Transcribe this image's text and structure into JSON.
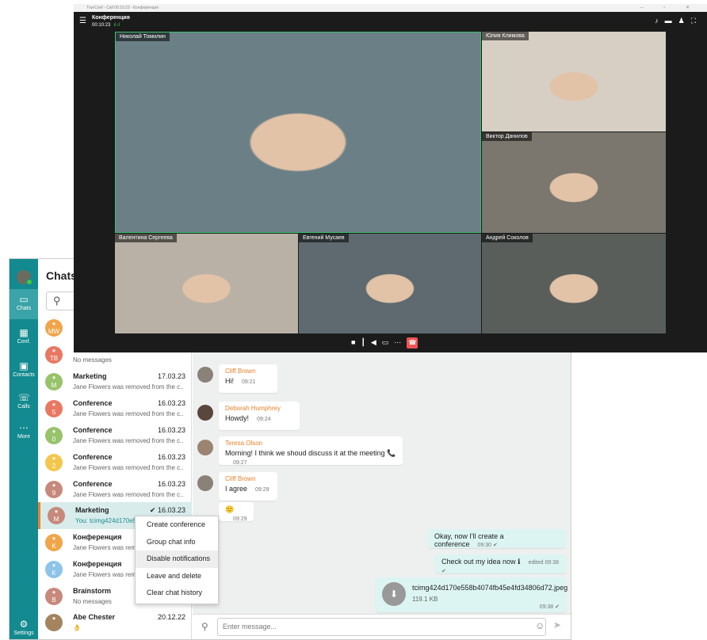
{
  "call": {
    "window_title": "TrueConf - Call 00:10:23 - Конференция",
    "conf_title": "Конференция",
    "timer": "00:10:23",
    "signal": "ıl ıl",
    "participants": [
      {
        "name": "Николай Томилин",
        "bg": "#6b7f86"
      },
      {
        "name": "Юлия Климова",
        "bg": "#d7cfc4"
      },
      {
        "name": "Виктор Данилов",
        "bg": "#7b766e"
      },
      {
        "name": "Валентина Сергеева",
        "bg": "#b9b1a6"
      },
      {
        "name": "Евгений Мусаев",
        "bg": "#5f6a70"
      },
      {
        "name": "Андрей Соколов",
        "bg": "#5a5e5b"
      }
    ]
  },
  "sidebar": {
    "items": [
      {
        "label": "Chats"
      },
      {
        "label": "Conf."
      },
      {
        "label": "Contacts"
      },
      {
        "label": "Calls"
      },
      {
        "label": "More"
      },
      {
        "label": "Settings"
      }
    ]
  },
  "chats": {
    "title": "Chats",
    "rows": [
      {
        "initials": "MW",
        "name": "",
        "date": "",
        "sub": "",
        "color": "#f0a54a"
      },
      {
        "initials": "TB",
        "name": "",
        "date": "",
        "sub": "No messages",
        "color": "#e97862"
      },
      {
        "initials": "M",
        "name": "Marketing",
        "date": "17.03.23",
        "sub": "Jane Flowers was removed from the c...",
        "color": "#97c36b"
      },
      {
        "initials": "5",
        "name": "Conference",
        "date": "16.03.23",
        "sub": "Jane Flowers was removed from the c...",
        "color": "#e97862"
      },
      {
        "initials": "0",
        "name": "Conference",
        "date": "16.03.23",
        "sub": "Jane Flowers was removed from the c...",
        "color": "#97c36b"
      },
      {
        "initials": "2",
        "name": "Conference",
        "date": "16.03.23",
        "sub": "Jane Flowers was removed from the c...",
        "color": "#f3c74d"
      },
      {
        "initials": "9",
        "name": "Conference",
        "date": "16.03.23",
        "sub": "Jane Flowers was removed from the c...",
        "color": "#c6897c"
      },
      {
        "initials": "M",
        "name": "Marketing",
        "date": "✔ 16.03.23",
        "sub": "You: tcimg424d170e55",
        "color": "#c6897c"
      },
      {
        "initials": "K",
        "name": "Конференция",
        "date": "",
        "sub": "Jane Flowers was remo",
        "color": "#f0a54a"
      },
      {
        "initials": "K",
        "name": "Конференция",
        "date": "",
        "sub": "Jane Flowers was remo",
        "color": "#8dc4e8"
      },
      {
        "initials": "B",
        "name": "Brainstorm",
        "date": "",
        "sub": "No messages",
        "color": "#c6897c"
      },
      {
        "initials": "",
        "name": "Abe Chester",
        "date": "20.12.22",
        "sub": "👌",
        "color": "#a3845e"
      }
    ]
  },
  "messages": [
    {
      "who": "Cliff Brown",
      "text": "Hi!",
      "time": "09:21"
    },
    {
      "who": "Deborah Humphrey",
      "text": "Howdy!",
      "time": "09:24"
    },
    {
      "who": "Teresa Olson",
      "text": "Morning! I think we shoud discuss it at the meeting 📞",
      "time": "09:27"
    },
    {
      "who": "Cliff Brown",
      "text": "I agree",
      "time": "09:29"
    },
    {
      "who": "",
      "text": "🙂",
      "time": "09:29"
    },
    {
      "who": "",
      "text": "Okay, now I'll create a conference",
      "time": "09:30 ✔"
    },
    {
      "who": "",
      "text": "Check out my idea now ℹ",
      "time": "edited 09:38 ✔"
    },
    {
      "who": "",
      "text": "tcimg424d170e558b4074fb45e4fd34806d72.jpeg",
      "time": "09:38 ✔",
      "size": "119.1 KB"
    }
  ],
  "input": {
    "placeholder": "Enter message..."
  },
  "context_menu": [
    "Create conference",
    "Group chat info",
    "Disable notifications",
    "Leave and delete",
    "Clear chat history"
  ]
}
